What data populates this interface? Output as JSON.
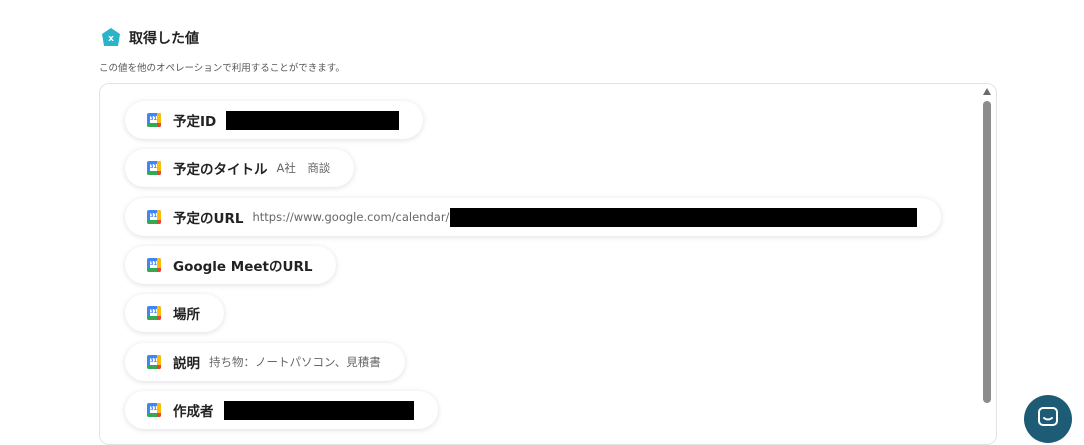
{
  "section": {
    "title": "取得した値",
    "badge_letter": "x",
    "subtitle": "この値を他のオペレーションで利用することができます。"
  },
  "items": [
    {
      "icon": "google-calendar-icon",
      "label": "予定ID",
      "value": "",
      "redacted": true
    },
    {
      "icon": "google-calendar-icon",
      "label": "予定のタイトル",
      "value": "A社　商談",
      "redacted": false
    },
    {
      "icon": "google-calendar-icon",
      "label": "予定のURL",
      "value": "https://www.google.com/calendar/",
      "redacted": true
    },
    {
      "icon": "google-calendar-icon",
      "label": "Google MeetのURL",
      "value": "",
      "redacted": false
    },
    {
      "icon": "google-calendar-icon",
      "label": "場所",
      "value": "",
      "redacted": false
    },
    {
      "icon": "google-calendar-icon",
      "label": "説明",
      "value": "持ち物：ノートパソコン、見積書",
      "redacted": false
    },
    {
      "icon": "google-calendar-icon",
      "label": "作成者",
      "value": "",
      "redacted": true
    }
  ],
  "colors": {
    "badge": "#2ab3c9",
    "chat_button": "#1e5c76"
  },
  "icons": {
    "section_badge": "x-badge-icon",
    "chat": "chat-icon",
    "scroll_up": "scroll-up-arrow-icon"
  }
}
